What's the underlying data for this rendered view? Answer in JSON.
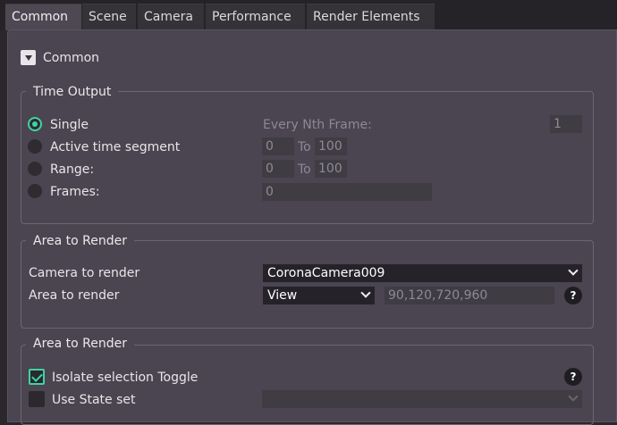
{
  "tabs": [
    "Common",
    "Scene",
    "Camera",
    "Performance",
    "Render Elements"
  ],
  "rollout": {
    "title": "Common"
  },
  "time_output": {
    "title": "Time Output",
    "options": [
      "Single",
      "Active time segment",
      "Range:",
      "Frames:"
    ],
    "selected": "Single",
    "every_nth_label": "Every Nth Frame:",
    "every_nth_value": "1",
    "active_from": "0",
    "active_to": "100",
    "range_from": "0",
    "range_to": "100",
    "to_label": "To",
    "frames_value": "0"
  },
  "area_to_render_1": {
    "title": "Area to Render",
    "camera_label": "Camera to render",
    "camera_value": "CoronaCamera009",
    "area_label": "Area to render",
    "area_value": "View",
    "region_value": "90,120,720,960",
    "help": "?"
  },
  "area_to_render_2": {
    "title": "Area to Render",
    "isolate_label": "Isolate selection Toggle",
    "isolate_checked": true,
    "state_set_label": "Use State set",
    "state_set_checked": false,
    "state_set_value": "",
    "help": "?"
  },
  "colors": {
    "accent": "#3ed3a5",
    "panel": "#4a4550",
    "background": "#2b282d"
  }
}
